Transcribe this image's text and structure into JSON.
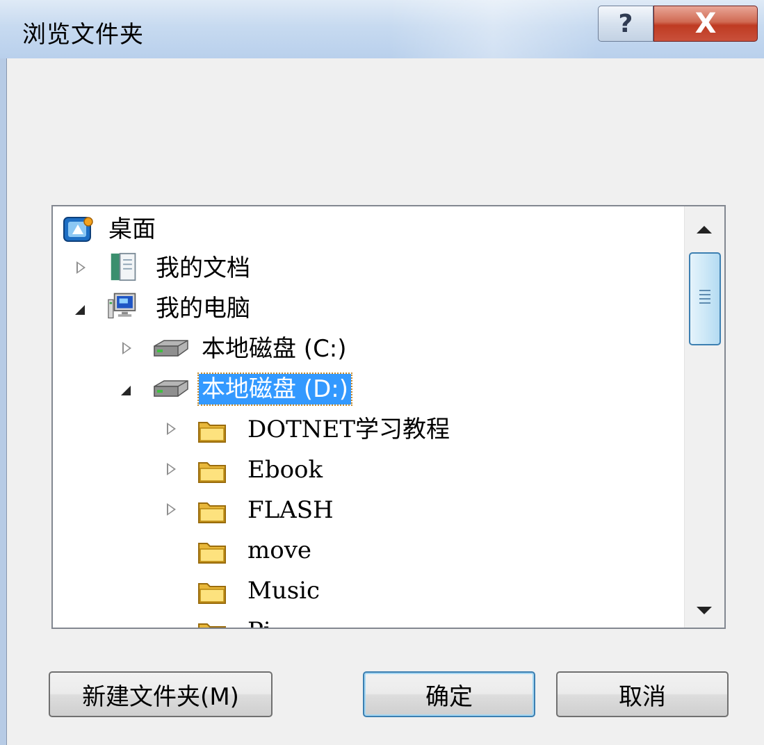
{
  "window": {
    "title": "浏览文件夹",
    "help_label": "?",
    "close_label": "X"
  },
  "tree": {
    "items": [
      {
        "label": "桌面",
        "icon": "desktop-icon",
        "expander": "none"
      },
      {
        "label": "我的文档",
        "icon": "documents-icon",
        "expander": "collapsed"
      },
      {
        "label": "我的电脑",
        "icon": "computer-icon",
        "expander": "expanded"
      },
      {
        "label": "本地磁盘 (C:)",
        "icon": "drive-icon",
        "expander": "collapsed"
      },
      {
        "label": "本地磁盘 (D:)",
        "icon": "drive-icon",
        "expander": "expanded",
        "selected": true
      },
      {
        "label": "DOTNET学习教程",
        "icon": "folder-icon",
        "expander": "collapsed"
      },
      {
        "label": "Ebook",
        "icon": "folder-icon",
        "expander": "collapsed"
      },
      {
        "label": "FLASH",
        "icon": "folder-icon",
        "expander": "collapsed"
      },
      {
        "label": "move",
        "icon": "folder-icon",
        "expander": "none"
      },
      {
        "label": "Music",
        "icon": "folder-icon",
        "expander": "none"
      },
      {
        "label": "Pi",
        "icon": "folder-icon",
        "expander": "none"
      }
    ]
  },
  "buttons": {
    "new_folder": "新建文件夹(M)",
    "ok": "确定",
    "cancel": "取消"
  },
  "colors": {
    "selection": "#3399ff",
    "title_bar": "#c7daf0",
    "close_button": "#c9503b"
  }
}
